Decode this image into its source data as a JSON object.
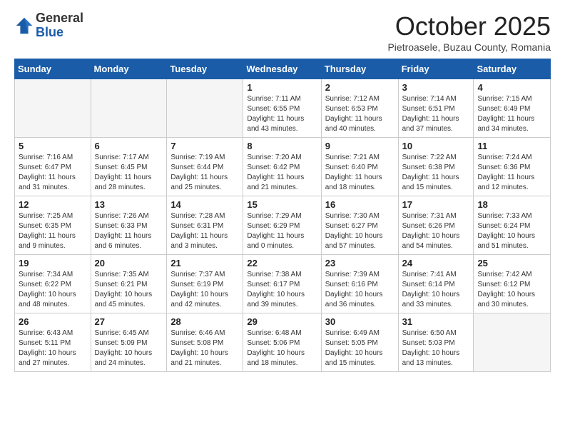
{
  "logo": {
    "general": "General",
    "blue": "Blue"
  },
  "header": {
    "month": "October 2025",
    "location": "Pietroasele, Buzau County, Romania"
  },
  "weekdays": [
    "Sunday",
    "Monday",
    "Tuesday",
    "Wednesday",
    "Thursday",
    "Friday",
    "Saturday"
  ],
  "weeks": [
    [
      {
        "day": "",
        "info": ""
      },
      {
        "day": "",
        "info": ""
      },
      {
        "day": "",
        "info": ""
      },
      {
        "day": "1",
        "info": "Sunrise: 7:11 AM\nSunset: 6:55 PM\nDaylight: 11 hours\nand 43 minutes."
      },
      {
        "day": "2",
        "info": "Sunrise: 7:12 AM\nSunset: 6:53 PM\nDaylight: 11 hours\nand 40 minutes."
      },
      {
        "day": "3",
        "info": "Sunrise: 7:14 AM\nSunset: 6:51 PM\nDaylight: 11 hours\nand 37 minutes."
      },
      {
        "day": "4",
        "info": "Sunrise: 7:15 AM\nSunset: 6:49 PM\nDaylight: 11 hours\nand 34 minutes."
      }
    ],
    [
      {
        "day": "5",
        "info": "Sunrise: 7:16 AM\nSunset: 6:47 PM\nDaylight: 11 hours\nand 31 minutes."
      },
      {
        "day": "6",
        "info": "Sunrise: 7:17 AM\nSunset: 6:45 PM\nDaylight: 11 hours\nand 28 minutes."
      },
      {
        "day": "7",
        "info": "Sunrise: 7:19 AM\nSunset: 6:44 PM\nDaylight: 11 hours\nand 25 minutes."
      },
      {
        "day": "8",
        "info": "Sunrise: 7:20 AM\nSunset: 6:42 PM\nDaylight: 11 hours\nand 21 minutes."
      },
      {
        "day": "9",
        "info": "Sunrise: 7:21 AM\nSunset: 6:40 PM\nDaylight: 11 hours\nand 18 minutes."
      },
      {
        "day": "10",
        "info": "Sunrise: 7:22 AM\nSunset: 6:38 PM\nDaylight: 11 hours\nand 15 minutes."
      },
      {
        "day": "11",
        "info": "Sunrise: 7:24 AM\nSunset: 6:36 PM\nDaylight: 11 hours\nand 12 minutes."
      }
    ],
    [
      {
        "day": "12",
        "info": "Sunrise: 7:25 AM\nSunset: 6:35 PM\nDaylight: 11 hours\nand 9 minutes."
      },
      {
        "day": "13",
        "info": "Sunrise: 7:26 AM\nSunset: 6:33 PM\nDaylight: 11 hours\nand 6 minutes."
      },
      {
        "day": "14",
        "info": "Sunrise: 7:28 AM\nSunset: 6:31 PM\nDaylight: 11 hours\nand 3 minutes."
      },
      {
        "day": "15",
        "info": "Sunrise: 7:29 AM\nSunset: 6:29 PM\nDaylight: 11 hours\nand 0 minutes."
      },
      {
        "day": "16",
        "info": "Sunrise: 7:30 AM\nSunset: 6:27 PM\nDaylight: 10 hours\nand 57 minutes."
      },
      {
        "day": "17",
        "info": "Sunrise: 7:31 AM\nSunset: 6:26 PM\nDaylight: 10 hours\nand 54 minutes."
      },
      {
        "day": "18",
        "info": "Sunrise: 7:33 AM\nSunset: 6:24 PM\nDaylight: 10 hours\nand 51 minutes."
      }
    ],
    [
      {
        "day": "19",
        "info": "Sunrise: 7:34 AM\nSunset: 6:22 PM\nDaylight: 10 hours\nand 48 minutes."
      },
      {
        "day": "20",
        "info": "Sunrise: 7:35 AM\nSunset: 6:21 PM\nDaylight: 10 hours\nand 45 minutes."
      },
      {
        "day": "21",
        "info": "Sunrise: 7:37 AM\nSunset: 6:19 PM\nDaylight: 10 hours\nand 42 minutes."
      },
      {
        "day": "22",
        "info": "Sunrise: 7:38 AM\nSunset: 6:17 PM\nDaylight: 10 hours\nand 39 minutes."
      },
      {
        "day": "23",
        "info": "Sunrise: 7:39 AM\nSunset: 6:16 PM\nDaylight: 10 hours\nand 36 minutes."
      },
      {
        "day": "24",
        "info": "Sunrise: 7:41 AM\nSunset: 6:14 PM\nDaylight: 10 hours\nand 33 minutes."
      },
      {
        "day": "25",
        "info": "Sunrise: 7:42 AM\nSunset: 6:12 PM\nDaylight: 10 hours\nand 30 minutes."
      }
    ],
    [
      {
        "day": "26",
        "info": "Sunrise: 6:43 AM\nSunset: 5:11 PM\nDaylight: 10 hours\nand 27 minutes."
      },
      {
        "day": "27",
        "info": "Sunrise: 6:45 AM\nSunset: 5:09 PM\nDaylight: 10 hours\nand 24 minutes."
      },
      {
        "day": "28",
        "info": "Sunrise: 6:46 AM\nSunset: 5:08 PM\nDaylight: 10 hours\nand 21 minutes."
      },
      {
        "day": "29",
        "info": "Sunrise: 6:48 AM\nSunset: 5:06 PM\nDaylight: 10 hours\nand 18 minutes."
      },
      {
        "day": "30",
        "info": "Sunrise: 6:49 AM\nSunset: 5:05 PM\nDaylight: 10 hours\nand 15 minutes."
      },
      {
        "day": "31",
        "info": "Sunrise: 6:50 AM\nSunset: 5:03 PM\nDaylight: 10 hours\nand 13 minutes."
      },
      {
        "day": "",
        "info": ""
      }
    ]
  ]
}
